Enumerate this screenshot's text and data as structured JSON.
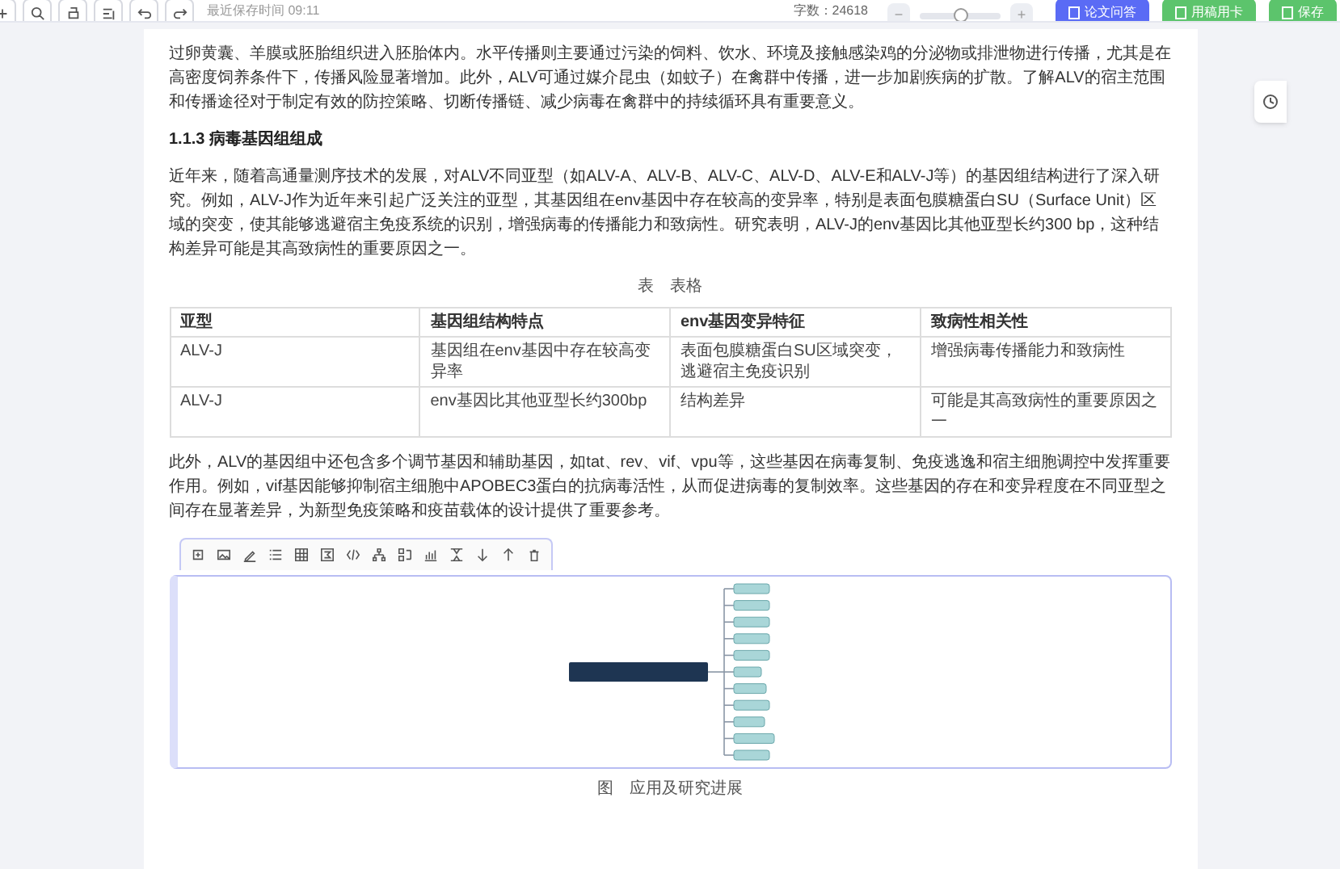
{
  "toolbar": {
    "save_time": "最近保存时间 09:11",
    "word_count": "字数：24618",
    "zoom": {
      "minus": "−",
      "plus": "+",
      "level": 0.5
    },
    "buttons": [
      {
        "label": "论文问答",
        "kind": "primary"
      },
      {
        "label": "用稿用卡",
        "kind": "success"
      },
      {
        "label": "保存",
        "kind": "success"
      }
    ]
  },
  "document": {
    "blocks": [
      {
        "kind": "paragraph",
        "text": "过卵黄囊、羊膜或胚胎组织进入胚胎体内。水平传播则主要通过污染的饲料、饮水、环境及接触感染鸡的分泌物或排泄物进行传播，尤其是在高密度饲养条件下，传播风险显著增加。此外，ALV可通过媒介昆虫（如蚊子）在禽群中传播，进一步加剧疾病的扩散。了解ALV的宿主范围和传播途径对于制定有效的防控策略、切断传播链、减少病毒在禽群中的持续循环具有重要意义。"
      },
      {
        "kind": "heading",
        "text": "1.1.3 病毒基因组组成"
      },
      {
        "kind": "paragraph",
        "text": "近年来，随着高通量测序技术的发展，对ALV不同亚型（如ALV-A、ALV-B、ALV-C、ALV-D、ALV-E和ALV-J等）的基因组结构进行了深入研究。例如，ALV-J作为近年来引起广泛关注的亚型，其基因组在env基因中存在较高的变异率，特别是表面包膜糖蛋白SU（Surface Unit）区域的突变，使其能够逃避宿主免疫系统的识别，增强病毒的传播能力和致病性。研究表明，ALV-J的env基因比其他亚型长约300 bp，这种结构差异可能是其高致病性的重要原因之一。"
      },
      {
        "kind": "caption",
        "text": "表　表格"
      },
      {
        "kind": "table",
        "columns": [
          "亚型",
          "基因组结构特点",
          "env基因变异特征",
          "致病性相关性"
        ],
        "rows": [
          [
            "ALV-J",
            "基因组在env基因中存在较高变异率",
            "表面包膜糖蛋白SU区域突变，逃避宿主免疫识别",
            "增强病毒传播能力和致病性"
          ],
          [
            "ALV-J",
            "env基因比其他亚型长约300bp",
            "结构差异",
            "可能是其高致病性的重要原因之一"
          ]
        ]
      },
      {
        "kind": "paragraph",
        "text": "此外，ALV的基因组中还包含多个调节基因和辅助基因，如tat、rev、vif、vpu等，这些基因在病毒复制、免疫逃逸和宿主细胞调控中发挥重要作用。例如，vif基因能够抑制宿主细胞中APOBEC3蛋白的抗病毒活性，从而促进病毒的复制效率。这些基因的存在和变异程度在不同亚型之间存在显著差异，为新型免疫策略和疫苗载体的设计提供了重要参考。"
      },
      {
        "kind": "mindmap"
      },
      {
        "kind": "caption",
        "text": "图　应用及研究进展"
      }
    ]
  }
}
